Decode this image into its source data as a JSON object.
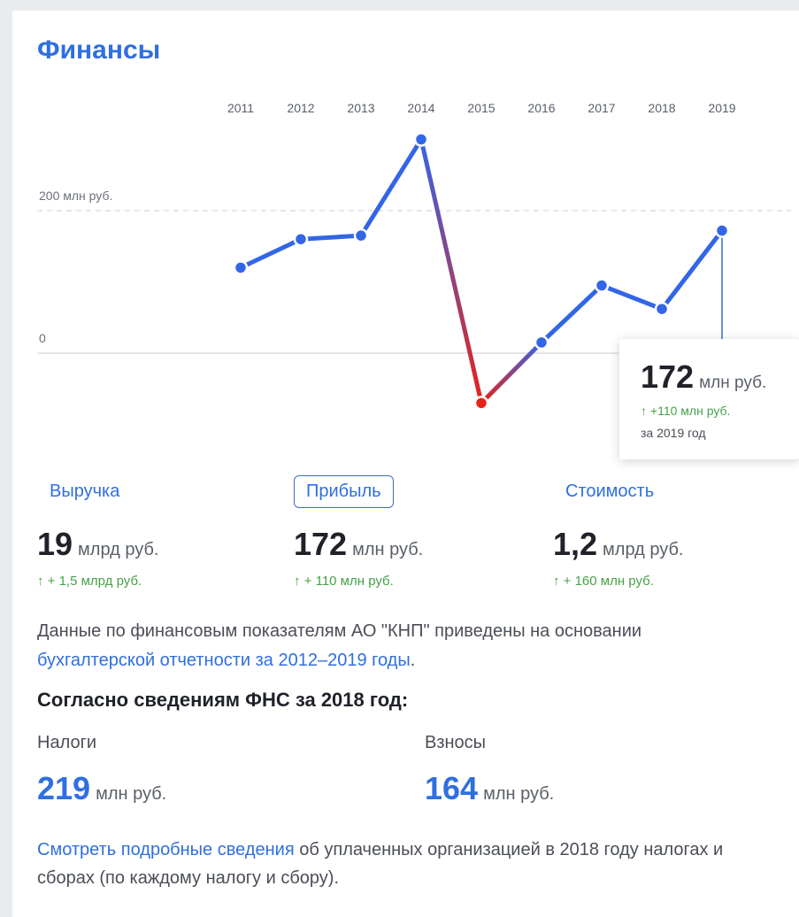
{
  "section_title": "Финансы",
  "chart_data": {
    "type": "line",
    "x": [
      "2011",
      "2012",
      "2013",
      "2014",
      "2015",
      "2016",
      "2017",
      "2018",
      "2019"
    ],
    "series": [
      {
        "values": [
          120,
          160,
          165,
          300,
          -70,
          15,
          95,
          62,
          172
        ]
      }
    ],
    "ylim": [
      -110,
      310
    ],
    "y_reference_labels": [
      {
        "value": 200,
        "label": "200 млн руб."
      },
      {
        "value": 0,
        "label": "0"
      }
    ],
    "colors": {
      "positive": "#3366e6",
      "negative": "#e8221b"
    },
    "grid": false
  },
  "tooltip": {
    "value": "172",
    "unit": "млн руб.",
    "delta": "↑ +110 млн руб.",
    "period": "за 2019 год"
  },
  "tabs": [
    {
      "label": "Выручка",
      "value": "19",
      "unit": "млрд руб.",
      "delta": "↑ + 1,5 млрд руб."
    },
    {
      "label": "Прибыль",
      "value": "172",
      "unit": "млн руб.",
      "delta": "↑ + 110 млн руб.",
      "active": true
    },
    {
      "label": "Стоимость",
      "value": "1,2",
      "unit": "млрд руб.",
      "delta": "↑ + 160 млн руб."
    }
  ],
  "note": {
    "text": "Данные по финансовым показателям АО \"КНП\" приведены на основании ",
    "link": "бухгалтерской отчетности за 2012–2019 годы",
    "end": "."
  },
  "fns": {
    "title": "Согласно сведениям ФНС за 2018 год:",
    "taxes_label": "Налоги",
    "taxes_value": "219",
    "taxes_unit": "млн руб.",
    "fees_label": "Взносы",
    "fees_value": "164",
    "fees_unit": "млн руб."
  },
  "footer": {
    "link": "Смотреть подробные сведения",
    "text": " об уплаченных организацией в 2018 году налогах и сборах (по каждому налогу и сбору)."
  },
  "colors": {
    "accent": "#2f6fe0",
    "positive_delta": "#47a14a"
  }
}
